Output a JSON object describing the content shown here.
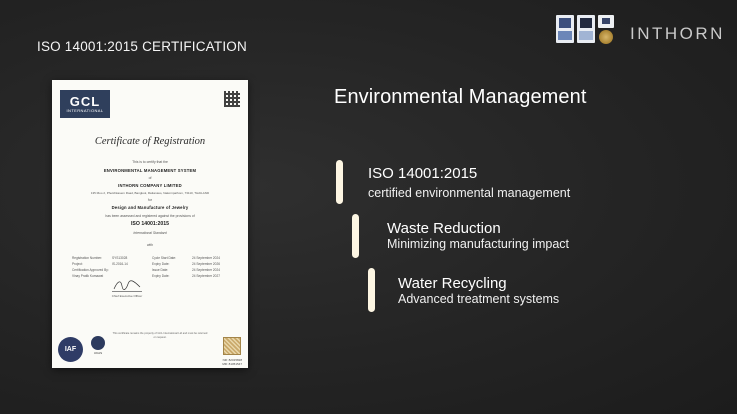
{
  "header": {
    "title": "ISO 14001:2015 CERTIFICATION",
    "brand": "INTHORN"
  },
  "certificate": {
    "logo_main": "GCL",
    "logo_sub": "INTERNATIONAL",
    "heading": "Certificate of Registration",
    "certify_line": "This is to certify that the",
    "system": "ENVIRONMENTAL MANAGEMENT SYSTEM",
    "of": "of",
    "company": "INTHORN COMPANY LIMITED",
    "address": "135 Moo 2, Phetchkasem Road, Bangkok, Rattanaso, Nakornpathom, 73110, THAILAND",
    "for": "for",
    "scope": "Design and Manufacture of Jewelry",
    "assessed": "has been assessed and registered against the provisions of",
    "standard": "ISO 14001:2015",
    "standard_note": "International Standard",
    "with": "with",
    "rows": [
      [
        "Registration Number:",
        "SYS13028",
        "Cycle Start Date:",
        "24 September 2024"
      ],
      [
        "Project:",
        "IS-2016-14",
        "Expiry Date:",
        "24 September 2026"
      ],
      [
        "Certification Approved By:",
        "",
        "Issue Date:",
        "24 September 2024"
      ],
      [
        "Vinay Pratik Kumawat",
        "",
        "Expiry Date:",
        "24 September 2027"
      ]
    ],
    "signature_title": "Chief Executive Officer",
    "footer_note": "This certificate remains the property of GCL International Ltd and must be returned on request.",
    "iaf": "IAF",
    "ukas": "UKAS",
    "codes": [
      "NR: 82015828",
      "MR: 81051547"
    ]
  },
  "content": {
    "section_title": "Environmental Management",
    "features": [
      {
        "title": "ISO 14001:2015",
        "desc": "certified environmental management"
      },
      {
        "title": "Waste Reduction",
        "desc": "Minimizing manufacturing impact"
      },
      {
        "title": "Water Recycling",
        "desc": "Advanced treatment systems"
      }
    ]
  }
}
